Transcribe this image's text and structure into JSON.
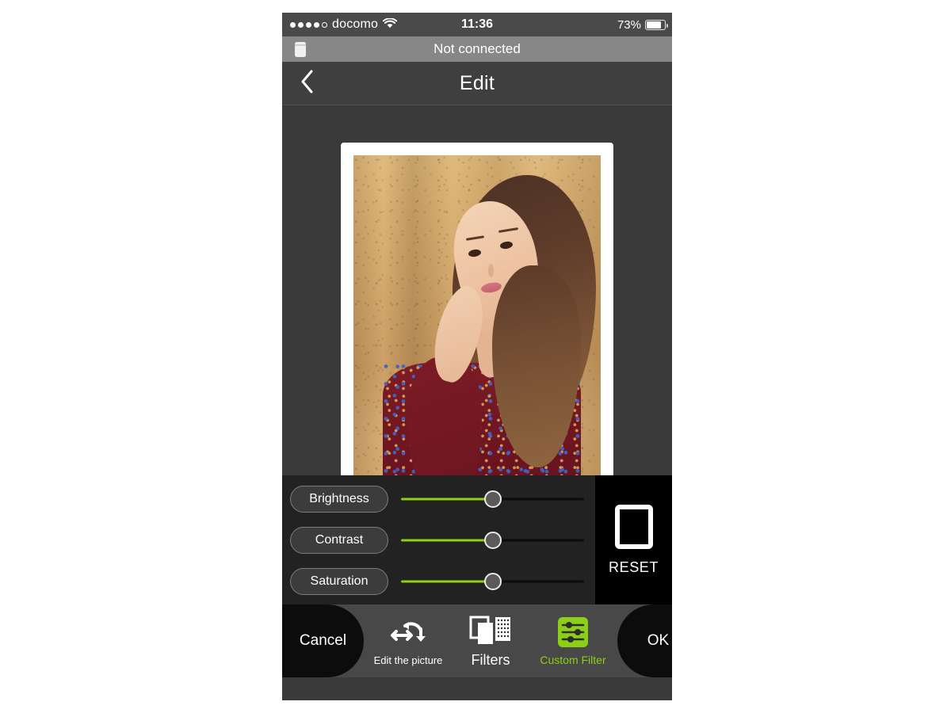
{
  "status_bar": {
    "signal_dots_filled": 4,
    "signal_dots_total": 5,
    "carrier": "docomo",
    "wifi_icon": "wifi-icon",
    "time": "11:36",
    "battery_percent": "73%",
    "battery_level": 73
  },
  "connection_bar": {
    "icon": "printer-icon",
    "text": "Not connected"
  },
  "nav_bar": {
    "back_icon": "chevron-left-icon",
    "title": "Edit"
  },
  "sliders": {
    "items": [
      {
        "label": "Brightness",
        "value": 50
      },
      {
        "label": "Contrast",
        "value": 50
      },
      {
        "label": "Saturation",
        "value": 50
      }
    ],
    "reset": {
      "label": "RESET",
      "icon": "polaroid-frame-icon"
    },
    "accent_color": "#8bd016",
    "track_color": "#0b0b0b"
  },
  "toolbar": {
    "cancel_label": "Cancel",
    "ok_label": "OK",
    "tools": [
      {
        "label": "Edit the picture",
        "icon": "transform-arrows-icon",
        "active": false
      },
      {
        "label": "Filters",
        "icon": "filters-layers-icon",
        "active": false
      },
      {
        "label": "Custom Filter",
        "icon": "sliders-icon",
        "active": true
      }
    ],
    "active_color": "#8bd016"
  }
}
